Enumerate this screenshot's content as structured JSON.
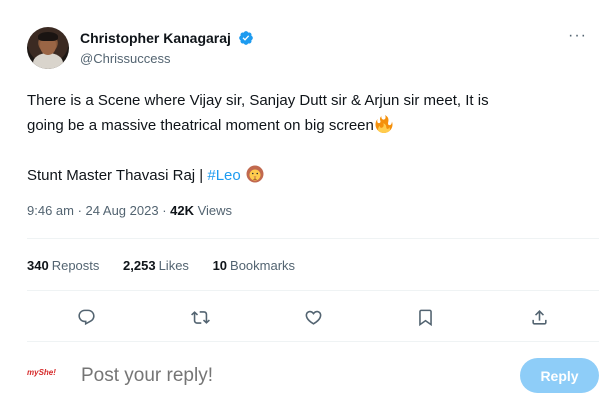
{
  "author": {
    "display_name": "Christopher Kanagaraj",
    "handle": "@Chrissuccess",
    "verified": true
  },
  "more_label": "···",
  "tweet": {
    "line1": "There is a Scene where Vijay sir, Sanjay Dutt sir & Arjun sir meet, It is",
    "line2": "going be a massive theatrical moment on big screen",
    "line3_prefix": "Stunt Master Thavasi Raj | ",
    "hashtag": "#Leo",
    "emoji_line2": "fire-emoji",
    "emoji_line3": "lion-emoji"
  },
  "meta": {
    "time": "9:46 am",
    "separator": " · ",
    "date": "24 Aug 2023",
    "separator2": " · ",
    "views_count": "42K",
    "views_label": " Views"
  },
  "stats": {
    "reposts_count": "340",
    "reposts_label": "Reposts",
    "likes_count": "2,253",
    "likes_label": "Likes",
    "bookmarks_count": "10",
    "bookmarks_label": "Bookmarks"
  },
  "actions": [
    {
      "icon": "reply-icon"
    },
    {
      "icon": "repost-icon"
    },
    {
      "icon": "like-icon"
    },
    {
      "icon": "bookmark-icon"
    },
    {
      "icon": "share-icon"
    }
  ],
  "reply": {
    "avatar_text": "myShe!",
    "placeholder": "Post your reply!",
    "button_label": "Reply"
  },
  "colors": {
    "accent": "#1d9bf0",
    "reply_button": "#8ecdf8",
    "secondary_text": "#536471"
  }
}
